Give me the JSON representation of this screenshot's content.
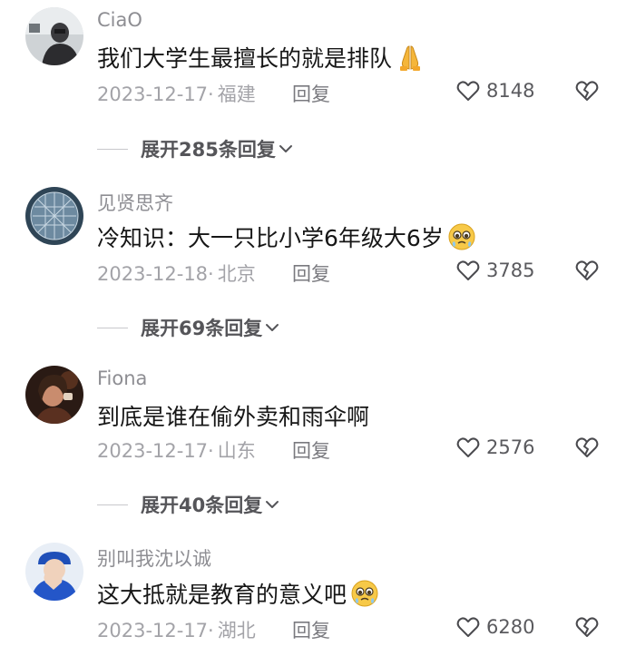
{
  "comments": [
    {
      "username": "CiaO",
      "content": "我们大学生最擅长的就是排队",
      "emoji": "folded-hands-emoji",
      "date": "2023-12-17·",
      "location": "福建",
      "reply_label": "回复",
      "likes": "8148",
      "expand_label": "展开285条回复"
    },
    {
      "username": "见贤思齐",
      "content": "冷知识：大一只比小学6年级大6岁",
      "emoji": "pleading-face-emoji",
      "date": "2023-12-18·",
      "location": "北京",
      "reply_label": "回复",
      "likes": "3785",
      "expand_label": "展开69条回复"
    },
    {
      "username": "Fiona",
      "content": "到底是谁在偷外卖和雨伞啊",
      "emoji": "",
      "date": "2023-12-17·",
      "location": "山东",
      "reply_label": "回复",
      "likes": "2576",
      "expand_label": "展开40条回复"
    },
    {
      "username": "别叫我沈以诚",
      "content": "这大抵就是教育的意义吧",
      "emoji": "pleading-face-emoji",
      "date": "2023-12-17·",
      "location": "湖北",
      "reply_label": "回复",
      "likes": "6280",
      "expand_label": ""
    }
  ],
  "colors": {
    "username": "#8e8e93",
    "content": "#161616",
    "meta": "#a3a3a8",
    "icon": "#4a4a4e"
  }
}
